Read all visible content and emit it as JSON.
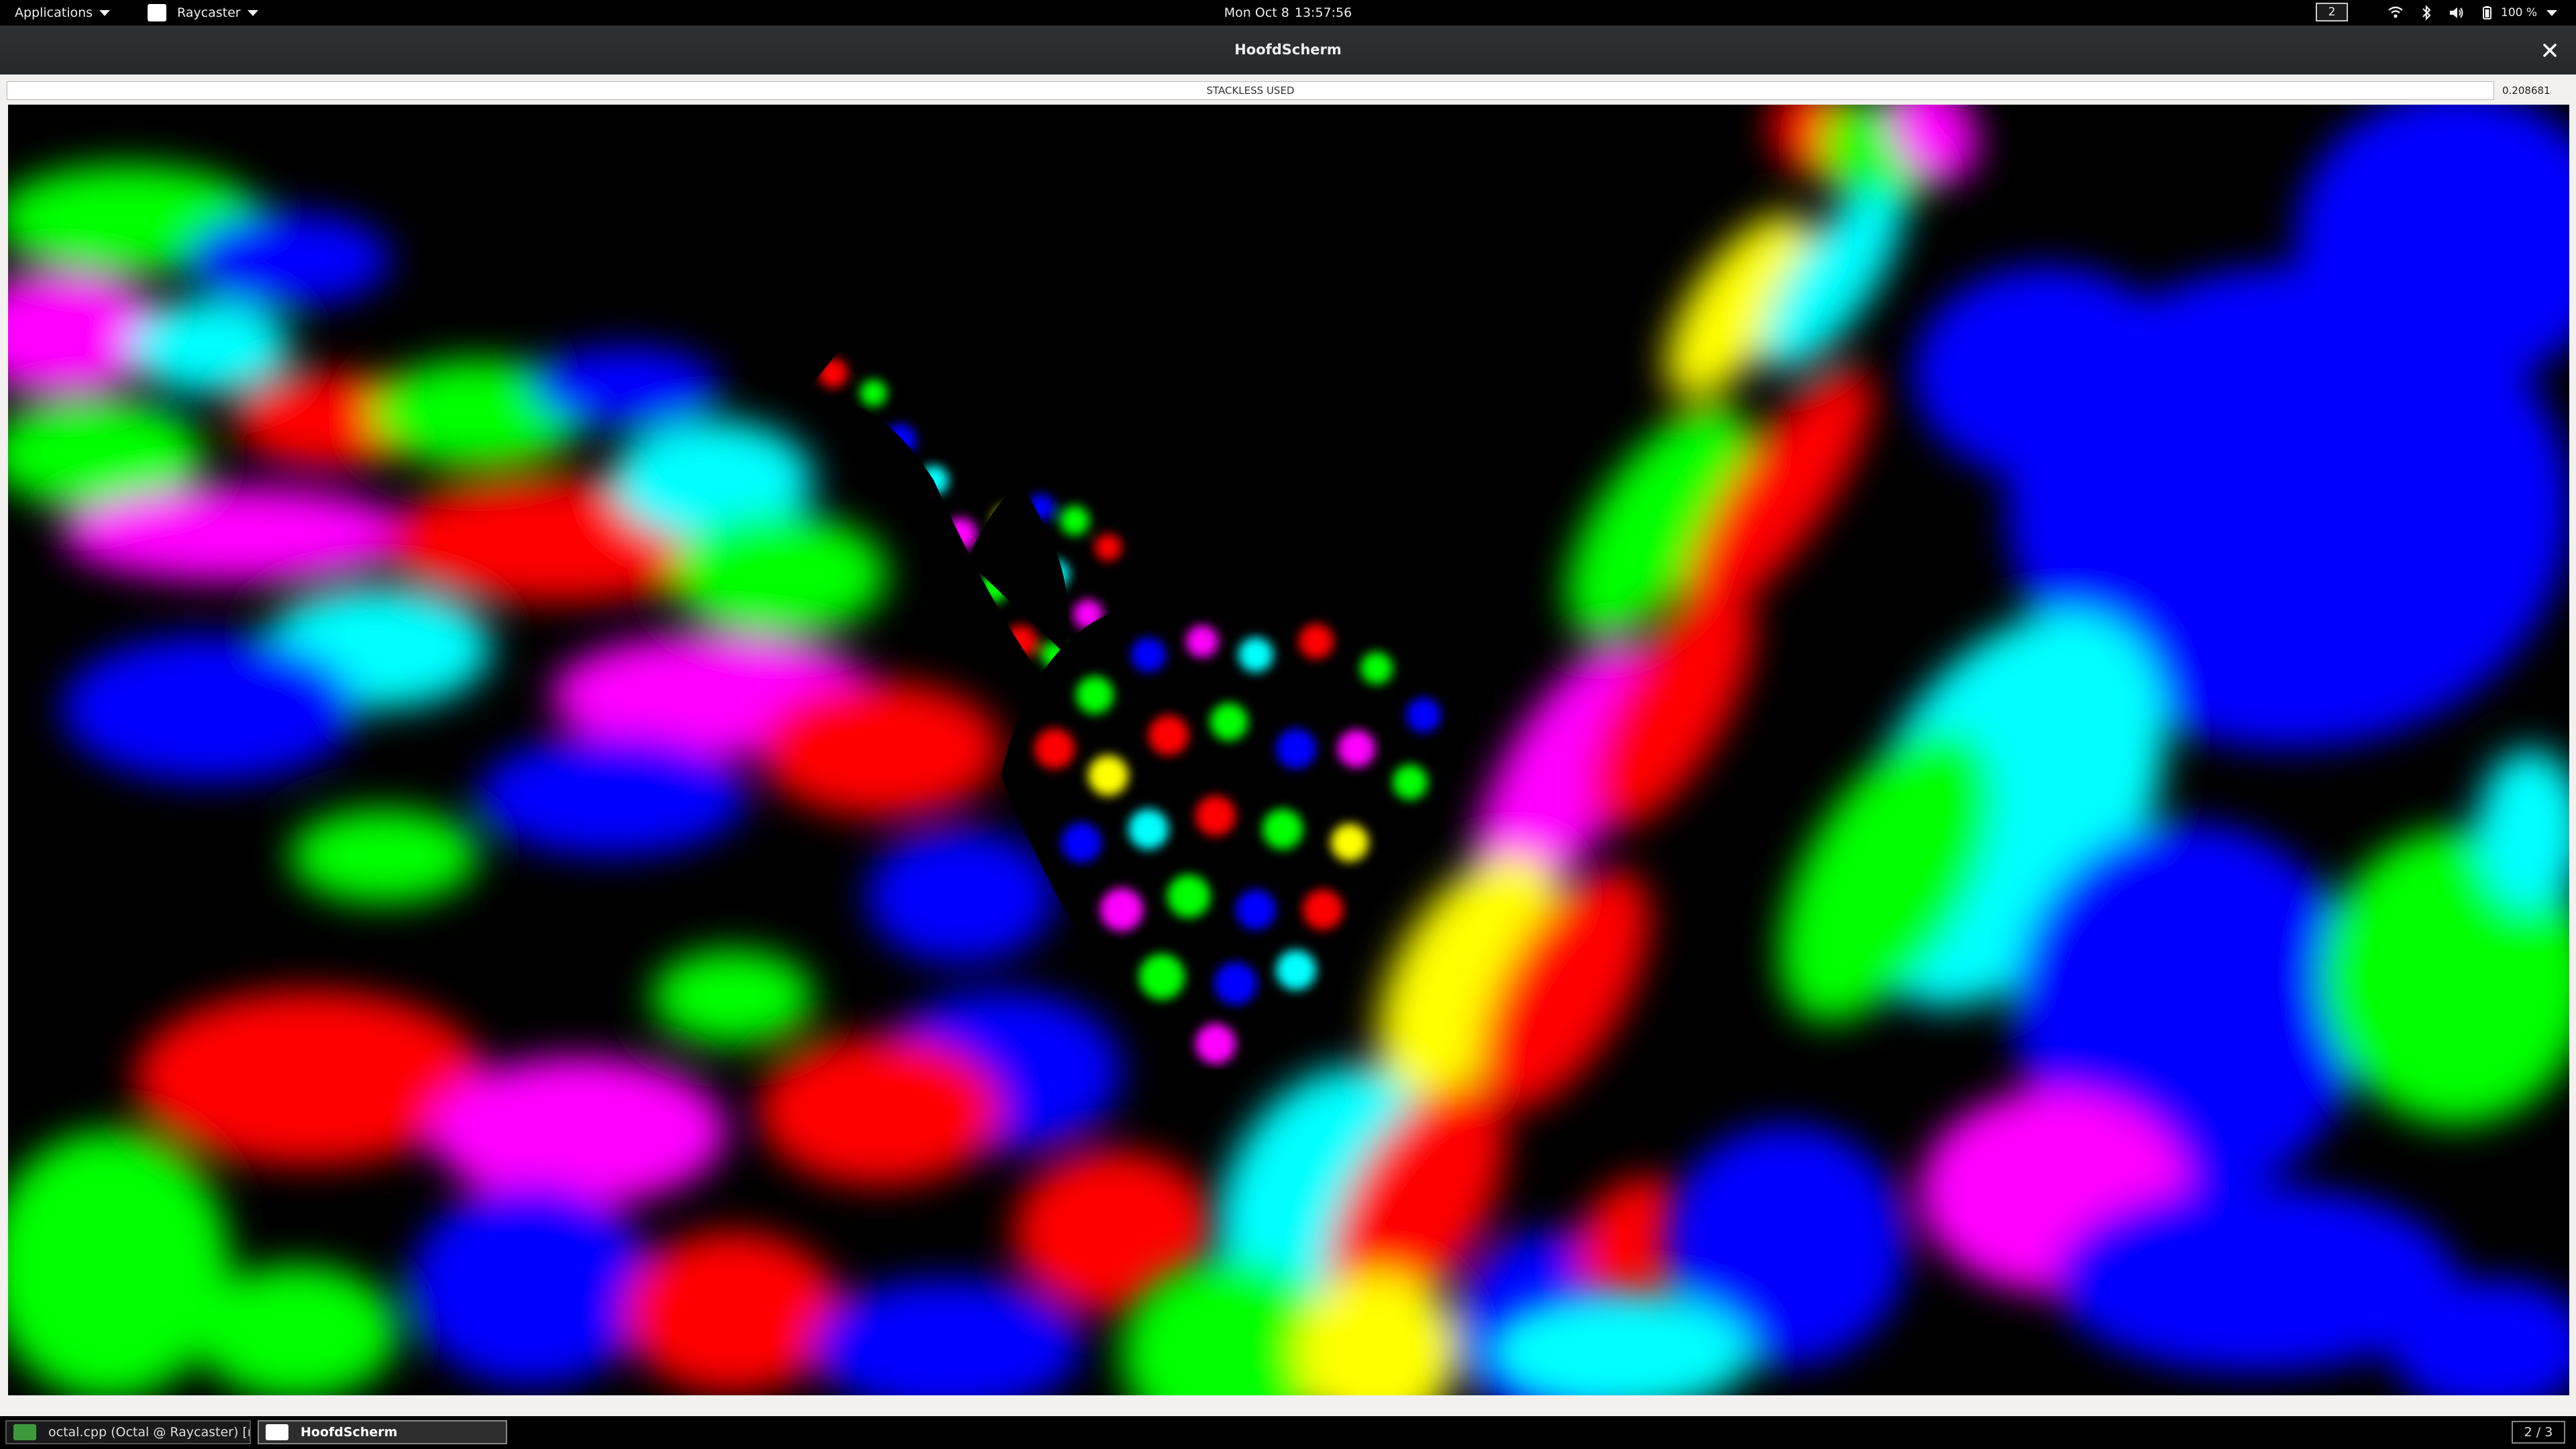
{
  "topbar": {
    "applications_label": "Applications",
    "app_menu_label": "Raycaster",
    "clock_day": "Mon Oct 8",
    "clock_time": "13:57:56",
    "workspace_number": "2",
    "battery_label": "100 %"
  },
  "window": {
    "title": "HoofdScherm",
    "status_text": "STACKLESS USED",
    "frame_time": "0.208681"
  },
  "taskbar": {
    "items": [
      {
        "label": "octal.cpp (Octal @ Raycaster) [m...",
        "icon": "qt-creator-icon",
        "active": false
      },
      {
        "label": "HoofdScherm",
        "icon": "window-icon",
        "active": true
      }
    ],
    "workspace_switcher": "2 / 3"
  },
  "render": {
    "colors": [
      "#ff0000",
      "#00ff00",
      "#0000ff",
      "#00ffff",
      "#ff00ff",
      "#ffff00"
    ]
  }
}
